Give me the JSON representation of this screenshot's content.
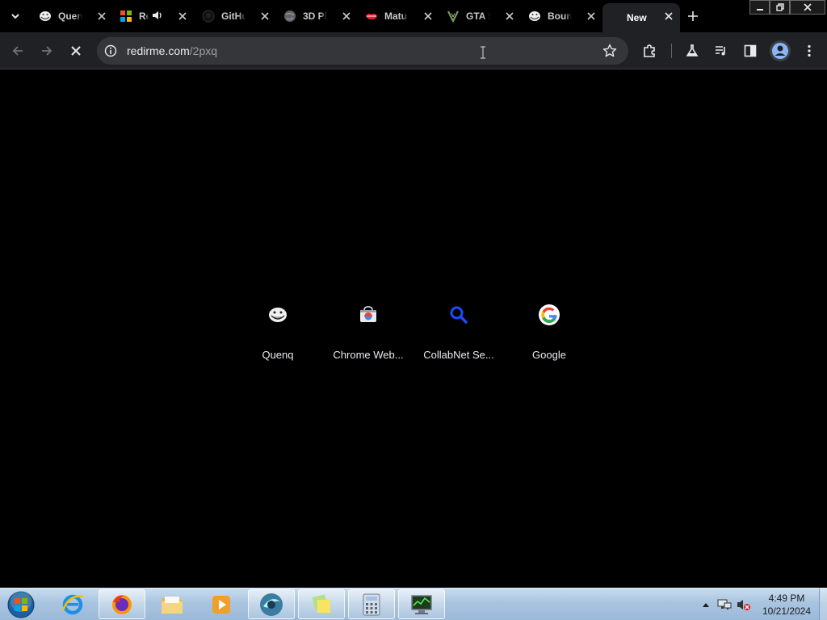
{
  "browser": {
    "tabs": [
      {
        "title": "Quen",
        "favicon": "troll-face-icon"
      },
      {
        "title": "Re",
        "favicon": "windows-logo-icon",
        "audio": true
      },
      {
        "title": "GitHu",
        "favicon": "github-icon"
      },
      {
        "title": "3D Pl",
        "favicon": "globe-icon"
      },
      {
        "title": "Matu",
        "favicon": "lips-icon"
      },
      {
        "title": "GTA 5",
        "favicon": "gta-icon"
      },
      {
        "title": "Boun",
        "favicon": "troll-face-icon"
      },
      {
        "title": "New",
        "favicon": "none",
        "active": true
      }
    ],
    "omnibox": {
      "host": "redirme.com",
      "path": "/2pxq"
    },
    "loading": true
  },
  "ntp": {
    "shortcuts": [
      {
        "label": "Quenq",
        "icon": "troll-face-icon"
      },
      {
        "label": "Chrome Web...",
        "icon": "chrome-web-store-icon"
      },
      {
        "label": "CollabNet Se...",
        "icon": "magnifier-icon"
      },
      {
        "label": "Google",
        "icon": "google-g-icon"
      }
    ]
  },
  "taskbar": {
    "apps": [
      "internet-explorer-icon",
      "firefox-icon",
      "file-explorer-icon",
      "media-player-icon",
      "browser-app-icon",
      "sticky-notes-icon",
      "calculator-icon",
      "system-monitor-icon"
    ],
    "clock": {
      "time": "4:49 PM",
      "date": "10/21/2024"
    }
  },
  "colors": {
    "page_bg": "#000000",
    "toolbar_bg": "#202124",
    "omnibox_bg": "#35363a",
    "taskbar_bg": "#a9c4df"
  }
}
